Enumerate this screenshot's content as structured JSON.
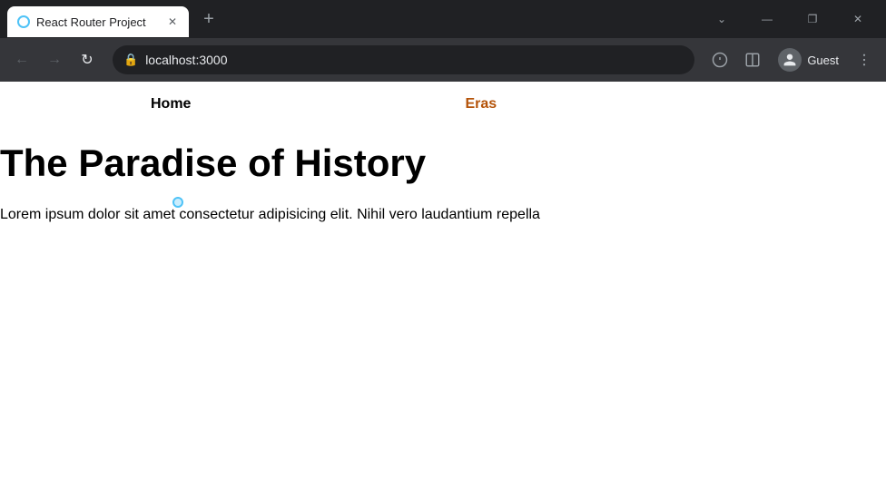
{
  "browser": {
    "tab": {
      "title": "React Router Project",
      "favicon_alt": "tab favicon"
    },
    "address": {
      "url": "localhost:3000"
    },
    "profile": {
      "name": "Guest"
    },
    "window_controls": {
      "minimize": "—",
      "maximize": "❐",
      "close": "✕"
    },
    "nav_buttons": {
      "back": "←",
      "forward": "→",
      "reload": "↻",
      "new_tab": "+"
    }
  },
  "page": {
    "nav": {
      "home_label": "Home",
      "eras_label": "Eras"
    },
    "heading": "The Paradise of History",
    "body_text": "Lorem ipsum dolor sit amet consectetur adipisicing elit. Nihil vero laudantium repella"
  }
}
